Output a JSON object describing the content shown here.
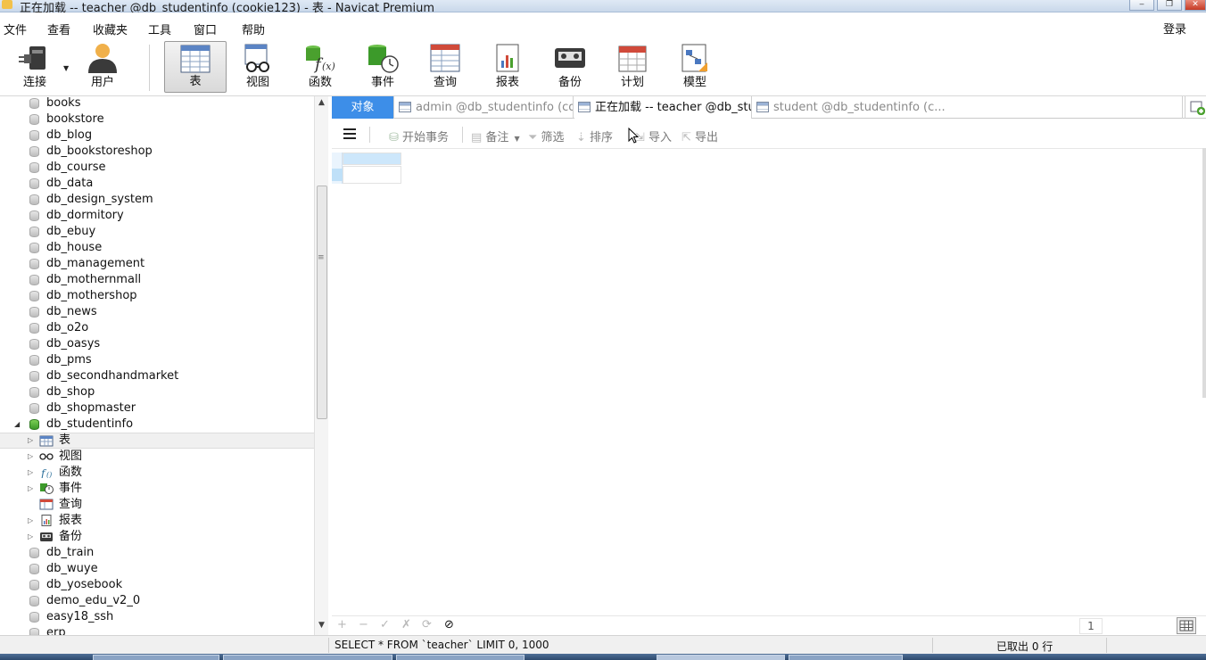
{
  "window": {
    "title": "正在加载 -- teacher @db_studentinfo (cookie123) - 表 - Navicat Premium"
  },
  "menu": {
    "items": [
      "文件",
      "查看",
      "收藏夹",
      "工具",
      "窗口",
      "帮助"
    ],
    "login": "登录"
  },
  "toolbar": {
    "buttons": [
      {
        "label": "连接",
        "icon": "plug-icon"
      },
      {
        "label": "用户",
        "icon": "user-icon"
      },
      {
        "label": "表",
        "icon": "table-icon"
      },
      {
        "label": "视图",
        "icon": "view-glasses-icon"
      },
      {
        "label": "函数",
        "icon": "function-icon"
      },
      {
        "label": "事件",
        "icon": "event-icon"
      },
      {
        "label": "查询",
        "icon": "query-icon"
      },
      {
        "label": "报表",
        "icon": "report-icon"
      },
      {
        "label": "备份",
        "icon": "backup-icon"
      },
      {
        "label": "计划",
        "icon": "calendar-icon"
      },
      {
        "label": "模型",
        "icon": "model-icon"
      }
    ],
    "active": "表"
  },
  "sidebar": {
    "databases_above": [
      "books",
      "bookstore",
      "db_blog",
      "db_bookstoreshop",
      "db_course",
      "db_data",
      "db_design_system",
      "db_dormitory",
      "db_ebuy",
      "db_house",
      "db_management",
      "db_mothernmall",
      "db_mothershop",
      "db_news",
      "db_o2o",
      "db_oasys",
      "db_pms",
      "db_secondhandmarket",
      "db_shop",
      "db_shopmaster"
    ],
    "open_database": "db_studentinfo",
    "children": [
      {
        "label": "表",
        "icon": "table-icon"
      },
      {
        "label": "视图",
        "icon": "view-glasses-icon"
      },
      {
        "label": "函数",
        "icon": "function-icon"
      },
      {
        "label": "事件",
        "icon": "event-icon"
      },
      {
        "label": "查询",
        "icon": "query-icon"
      },
      {
        "label": "报表",
        "icon": "report-icon"
      },
      {
        "label": "备份",
        "icon": "backup-icon"
      }
    ],
    "databases_below": [
      "db_train",
      "db_wuye",
      "db_yosebook",
      "demo_edu_v2_0",
      "easy18_ssh",
      "erp"
    ]
  },
  "tabs": {
    "object_tab": "对象",
    "items": [
      {
        "label": "admin @db_studentinfo (co...",
        "state": "inactive"
      },
      {
        "label": "正在加载 -- teacher @db_stu...",
        "state": "active"
      },
      {
        "label": "student @db_studentinfo (c...",
        "state": "inactive"
      }
    ]
  },
  "objbar": {
    "begin_transaction": "开始事务",
    "memo": "备注",
    "filter": "筛选",
    "sort": "排序",
    "import": "导入",
    "export": "导出"
  },
  "navbar": {
    "add": "+",
    "remove": "−",
    "apply": "✓",
    "cancel": "✗",
    "refresh": "⟳",
    "stop": "⊘",
    "page": "1"
  },
  "status": {
    "sql": "SELECT * FROM `teacher` LIMIT 0, 1000",
    "fetched": "已取出 0 行"
  },
  "colors": {
    "object_tab": "#3d8ee8",
    "open_db_icon": "#3c9a2a",
    "grid_selection": "#cde7fb"
  }
}
